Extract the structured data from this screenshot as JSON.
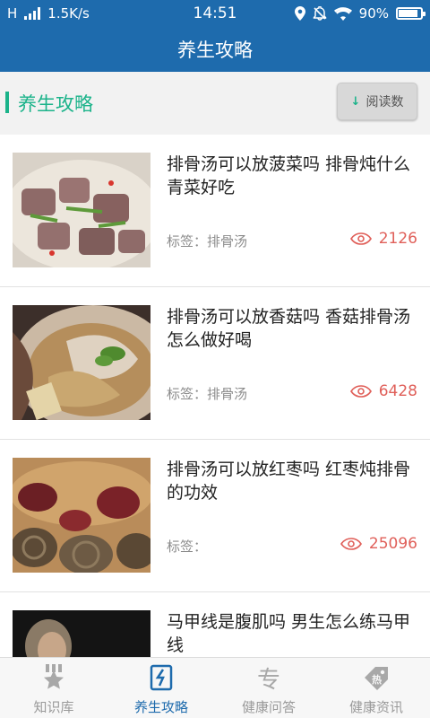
{
  "status": {
    "carrier": "H",
    "speed": "1.5K/s",
    "time": "14:51",
    "battery": "90%",
    "battery_level": 0.9
  },
  "header": {
    "title": "养生攻略"
  },
  "section": {
    "title": "养生攻略",
    "sort_label": "阅读数",
    "sort_icon": "down-arrow"
  },
  "colors": {
    "primary": "#1e6bad",
    "accent": "#1bb38a",
    "views": "#e0605a"
  },
  "articles": [
    {
      "title": "排骨汤可以放菠菜吗 排骨炖什么青菜好吃",
      "tag": "标签：排骨汤",
      "views": "2126"
    },
    {
      "title": "排骨汤可以放香菇吗 香菇排骨汤怎么做好喝",
      "tag": "标签：排骨汤",
      "views": "6428"
    },
    {
      "title": "排骨汤可以放红枣吗 红枣炖排骨的功效",
      "tag": "标签：",
      "views": "25096"
    },
    {
      "title": "马甲线是腹肌吗 男生怎么练马甲线",
      "tag": "",
      "views": ""
    }
  ],
  "tabs": [
    {
      "label": "知识库",
      "icon": "star-icon",
      "active": false
    },
    {
      "label": "养生攻略",
      "icon": "book-icon",
      "active": true
    },
    {
      "label": "健康问答",
      "icon": "zhuan-icon",
      "active": false
    },
    {
      "label": "健康资讯",
      "icon": "hot-tag-icon",
      "active": false
    }
  ]
}
